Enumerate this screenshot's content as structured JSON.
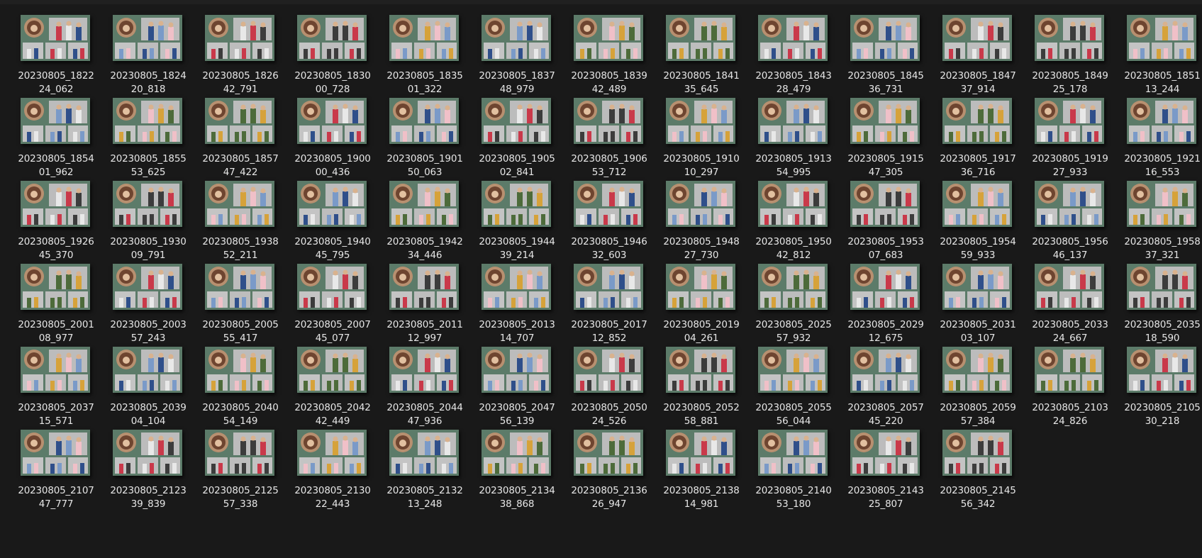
{
  "files": [
    {
      "name_line1": "20230805_1822",
      "name_line2": "24_062"
    },
    {
      "name_line1": "20230805_1824",
      "name_line2": "20_818"
    },
    {
      "name_line1": "20230805_1826",
      "name_line2": "42_791"
    },
    {
      "name_line1": "20230805_1830",
      "name_line2": "00_728"
    },
    {
      "name_line1": "20230805_1835",
      "name_line2": "01_322"
    },
    {
      "name_line1": "20230805_1837",
      "name_line2": "48_979"
    },
    {
      "name_line1": "20230805_1839",
      "name_line2": "42_489"
    },
    {
      "name_line1": "20230805_1841",
      "name_line2": "35_645"
    },
    {
      "name_line1": "20230805_1843",
      "name_line2": "28_479"
    },
    {
      "name_line1": "20230805_1845",
      "name_line2": "36_731"
    },
    {
      "name_line1": "20230805_1847",
      "name_line2": "37_914"
    },
    {
      "name_line1": "20230805_1849",
      "name_line2": "25_178"
    },
    {
      "name_line1": "20230805_1851",
      "name_line2": "13_244"
    },
    {
      "name_line1": "20230805_1854",
      "name_line2": "01_962"
    },
    {
      "name_line1": "20230805_1855",
      "name_line2": "53_625"
    },
    {
      "name_line1": "20230805_1857",
      "name_line2": "47_422"
    },
    {
      "name_line1": "20230805_1900",
      "name_line2": "00_436"
    },
    {
      "name_line1": "20230805_1901",
      "name_line2": "50_063"
    },
    {
      "name_line1": "20230805_1905",
      "name_line2": "02_841"
    },
    {
      "name_line1": "20230805_1906",
      "name_line2": "53_712"
    },
    {
      "name_line1": "20230805_1910",
      "name_line2": "10_297"
    },
    {
      "name_line1": "20230805_1913",
      "name_line2": "54_995"
    },
    {
      "name_line1": "20230805_1915",
      "name_line2": "47_305"
    },
    {
      "name_line1": "20230805_1917",
      "name_line2": "36_716"
    },
    {
      "name_line1": "20230805_1919",
      "name_line2": "27_933"
    },
    {
      "name_line1": "20230805_1921",
      "name_line2": "16_553"
    },
    {
      "name_line1": "20230805_1926",
      "name_line2": "45_370"
    },
    {
      "name_line1": "20230805_1930",
      "name_line2": "09_791"
    },
    {
      "name_line1": "20230805_1938",
      "name_line2": "52_211"
    },
    {
      "name_line1": "20230805_1940",
      "name_line2": "45_795"
    },
    {
      "name_line1": "20230805_1942",
      "name_line2": "34_446"
    },
    {
      "name_line1": "20230805_1944",
      "name_line2": "39_214"
    },
    {
      "name_line1": "20230805_1946",
      "name_line2": "32_603"
    },
    {
      "name_line1": "20230805_1948",
      "name_line2": "27_730"
    },
    {
      "name_line1": "20230805_1950",
      "name_line2": "42_812"
    },
    {
      "name_line1": "20230805_1953",
      "name_line2": "07_683"
    },
    {
      "name_line1": "20230805_1954",
      "name_line2": "59_933"
    },
    {
      "name_line1": "20230805_1956",
      "name_line2": "46_137"
    },
    {
      "name_line1": "20230805_1958",
      "name_line2": "37_321"
    },
    {
      "name_line1": "20230805_2001",
      "name_line2": "08_977"
    },
    {
      "name_line1": "20230805_2003",
      "name_line2": "57_243"
    },
    {
      "name_line1": "20230805_2005",
      "name_line2": "55_417"
    },
    {
      "name_line1": "20230805_2007",
      "name_line2": "45_077"
    },
    {
      "name_line1": "20230805_2011",
      "name_line2": "12_997"
    },
    {
      "name_line1": "20230805_2013",
      "name_line2": "14_707"
    },
    {
      "name_line1": "20230805_2017",
      "name_line2": "12_852"
    },
    {
      "name_line1": "20230805_2019",
      "name_line2": "04_261"
    },
    {
      "name_line1": "20230805_2025",
      "name_line2": "57_932"
    },
    {
      "name_line1": "20230805_2029",
      "name_line2": "12_675"
    },
    {
      "name_line1": "20230805_2031",
      "name_line2": "03_107"
    },
    {
      "name_line1": "20230805_2033",
      "name_line2": "24_667"
    },
    {
      "name_line1": "20230805_2035",
      "name_line2": "18_590"
    },
    {
      "name_line1": "20230805_2037",
      "name_line2": "15_571"
    },
    {
      "name_line1": "20230805_2039",
      "name_line2": "04_104"
    },
    {
      "name_line1": "20230805_2040",
      "name_line2": "54_149"
    },
    {
      "name_line1": "20230805_2042",
      "name_line2": "42_449"
    },
    {
      "name_line1": "20230805_2044",
      "name_line2": "47_936"
    },
    {
      "name_line1": "20230805_2047",
      "name_line2": "56_139"
    },
    {
      "name_line1": "20230805_2050",
      "name_line2": "24_526"
    },
    {
      "name_line1": "20230805_2052",
      "name_line2": "58_881"
    },
    {
      "name_line1": "20230805_2055",
      "name_line2": "56_044"
    },
    {
      "name_line1": "20230805_2057",
      "name_line2": "45_220"
    },
    {
      "name_line1": "20230805_2059",
      "name_line2": "57_384"
    },
    {
      "name_line1": "20230805_2103",
      "name_line2": "24_826"
    },
    {
      "name_line1": "20230805_2105",
      "name_line2": "30_218"
    },
    {
      "name_line1": "20230805_2107",
      "name_line2": "47_777"
    },
    {
      "name_line1": "20230805_2123",
      "name_line2": "39_839"
    },
    {
      "name_line1": "20230805_2125",
      "name_line2": "57_338"
    },
    {
      "name_line1": "20230805_2130",
      "name_line2": "22_443"
    },
    {
      "name_line1": "20230805_2132",
      "name_line2": "13_248"
    },
    {
      "name_line1": "20230805_2134",
      "name_line2": "38_868"
    },
    {
      "name_line1": "20230805_2136",
      "name_line2": "26_947"
    },
    {
      "name_line1": "20230805_2138",
      "name_line2": "14_981"
    },
    {
      "name_line1": "20230805_2140",
      "name_line2": "53_180"
    },
    {
      "name_line1": "20230805_2143",
      "name_line2": "25_807"
    },
    {
      "name_line1": "20230805_2145",
      "name_line2": "56_342"
    }
  ],
  "colors": {
    "background": "#191919",
    "label_text": "#e6e6e6",
    "thumb_frame": "#3f5a4e"
  },
  "icons": {
    "file_thumbnail": "photo-thumbnail-icon"
  }
}
